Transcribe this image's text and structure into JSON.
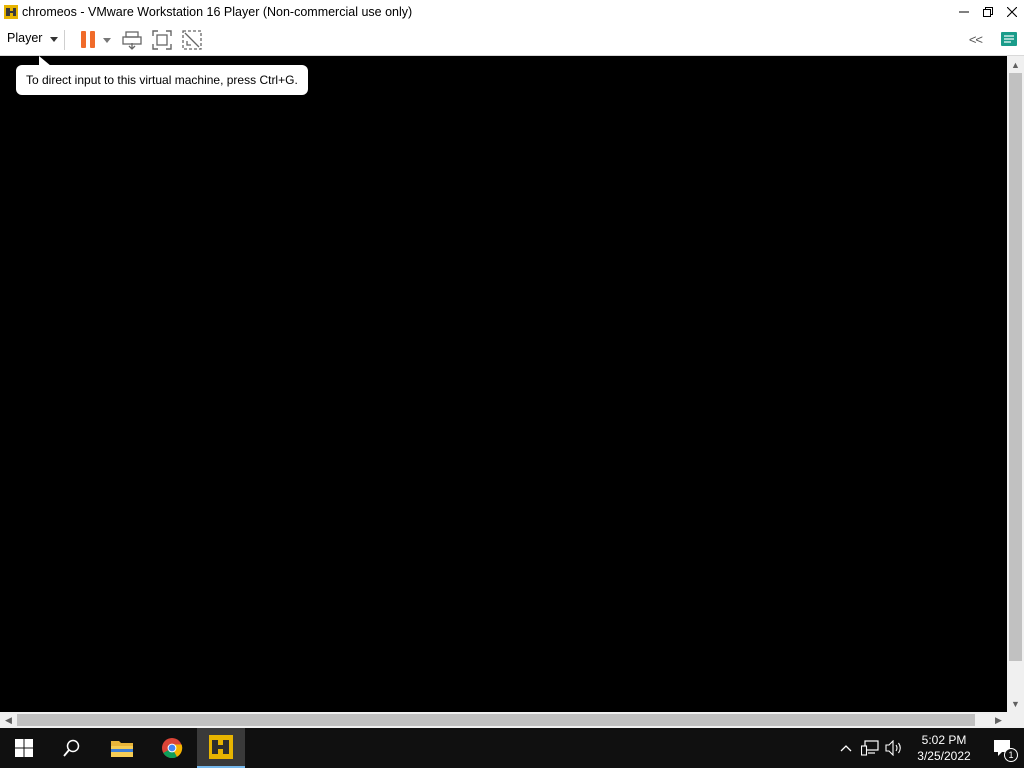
{
  "window": {
    "title": "chromeos - VMware Workstation 16 Player (Non-commercial use only)",
    "app_icon": "vmware-player-icon",
    "controls": {
      "minimize": "─",
      "restore": "❐",
      "close": "✕"
    }
  },
  "toolbar": {
    "player_menu_label": "Player",
    "icons": [
      "pause-icon",
      "send-ctrl-alt-del-icon",
      "full-screen-icon",
      "unity-icon"
    ],
    "collapse_label": "<<",
    "accent_color": "#f06b2a"
  },
  "vm": {
    "tooltip": "To direct input to this virtual machine, press Ctrl+G."
  },
  "scrollbars": {
    "up": "▲",
    "down": "▼",
    "left": "◀",
    "right": "▶"
  },
  "taskbar": {
    "apps": [
      "windows-start-icon",
      "search-icon",
      "file-explorer-icon",
      "chrome-icon",
      "vmware-player-icon"
    ],
    "tray": {
      "chevron": "^",
      "time": "5:02 PM",
      "date": "3/25/2022",
      "notification_count": "1"
    }
  }
}
